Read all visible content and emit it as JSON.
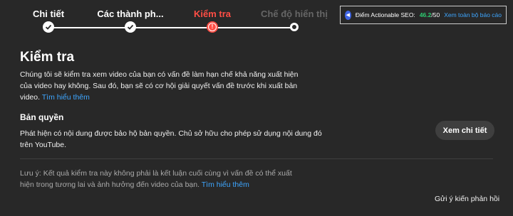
{
  "stepper": {
    "steps": [
      {
        "label": "Chi tiết",
        "state": "done"
      },
      {
        "label": "Các thành ph...",
        "state": "done"
      },
      {
        "label": "Kiểm tra",
        "state": "warning",
        "color": "#ff4e45"
      },
      {
        "label": "Chế độ hiển thị",
        "state": "upcoming",
        "color": "#666666"
      }
    ]
  },
  "seo": {
    "label": "Điểm Actionable SEO:",
    "score": "46.2",
    "total": "/50",
    "report_link": "Xem toàn bộ báo cáo"
  },
  "main": {
    "title": "Kiểm tra",
    "intro_text": "Chúng tôi sẽ kiểm tra xem video của bạn có vấn đề làm hạn chế khả năng xuất hiện của video hay không. Sau đó, bạn sẽ có cơ hội giải quyết vấn đề trước khi xuất bản video.",
    "intro_link": "Tìm hiểu thêm",
    "copyright": {
      "heading": "Bản quyền",
      "text": "Phát hiện có nội dung được bảo hộ bản quyền. Chủ sở hữu cho phép sử dụng nội dung đó trên YouTube.",
      "button": "Xem chi tiết"
    },
    "note_text": "Lưu ý: Kết quả kiểm tra này không phải là kết luận cuối cùng vì vấn đề có thể xuất hiện trong tương lai và ảnh hưởng đến video của bạn.",
    "note_link": "Tìm hiểu thêm",
    "feedback": "Gửi ý kiến phản hồi"
  }
}
